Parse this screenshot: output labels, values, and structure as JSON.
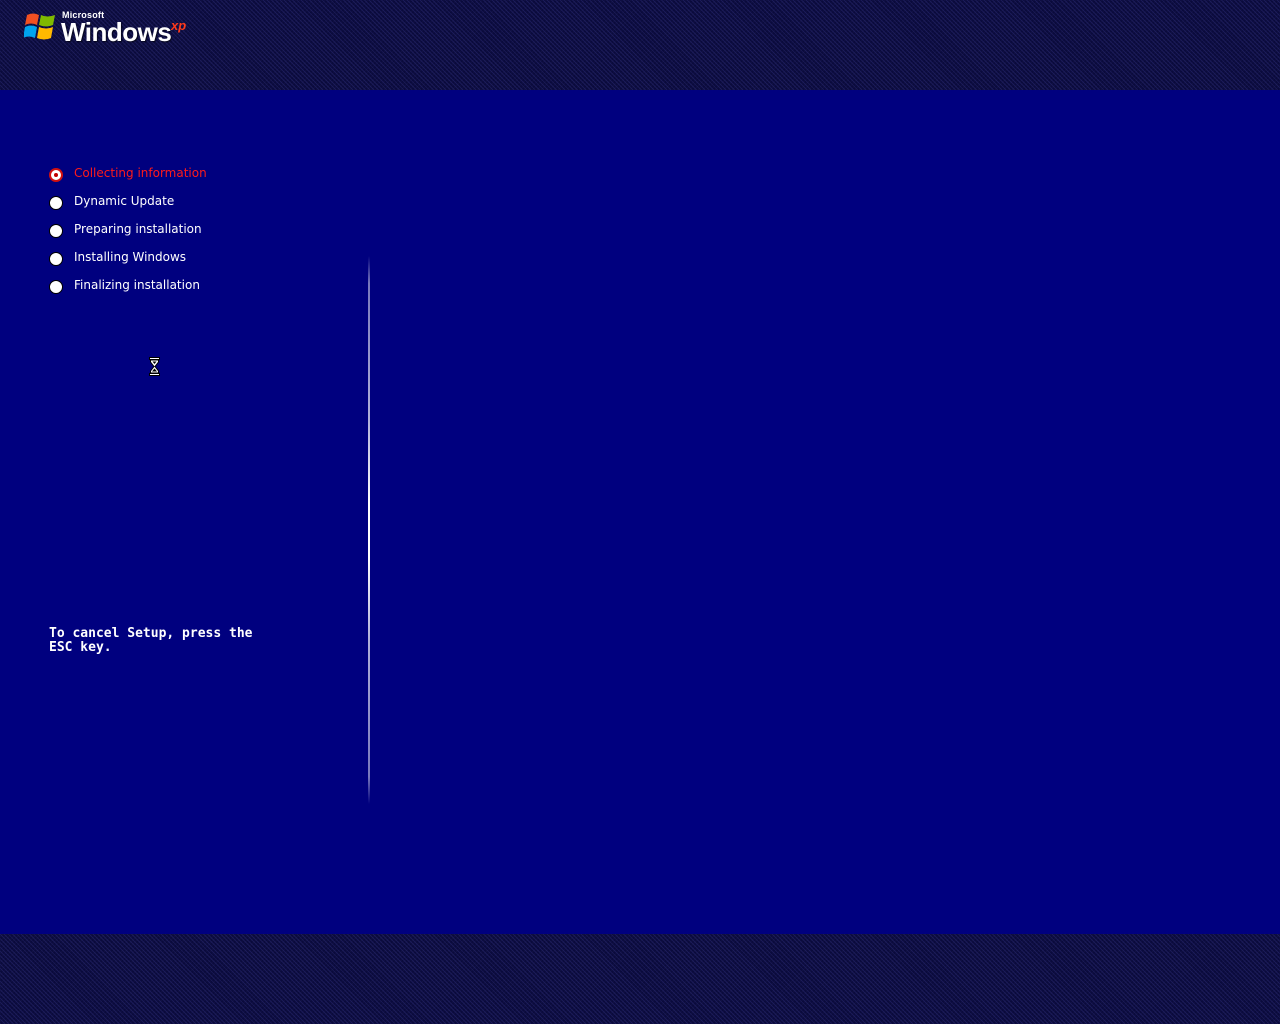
{
  "header": {
    "brand": "Microsoft",
    "product": "Windows",
    "edition": "xp",
    "logo_icon": "windows-flag-icon"
  },
  "steps": [
    {
      "label": "Collecting information",
      "state": "active"
    },
    {
      "label": "Dynamic Update",
      "state": "pending"
    },
    {
      "label": "Preparing installation",
      "state": "pending"
    },
    {
      "label": "Installing Windows",
      "state": "pending"
    },
    {
      "label": "Finalizing installation",
      "state": "pending"
    }
  ],
  "footer_note": "To cancel Setup, press the ESC key.",
  "cursor_icon": "hourglass-icon",
  "colors": {
    "background": "#00007f",
    "band": "#0a0a3c",
    "active_step": "#ff1a1a",
    "text": "#ffffff"
  }
}
